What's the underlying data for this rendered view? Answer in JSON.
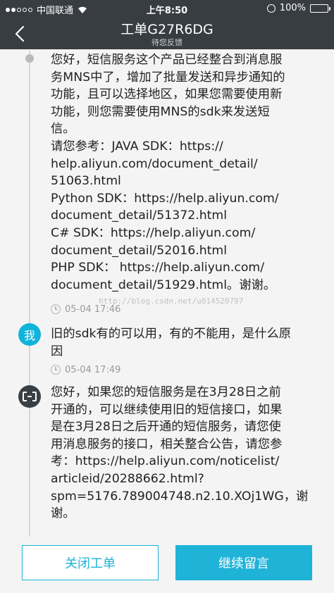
{
  "status_bar": {
    "carrier": "中国联通",
    "time": "上午8:50",
    "battery": "100%"
  },
  "header": {
    "title": "工单G27R6DG",
    "subtitle": "待您反馈"
  },
  "messages": [
    {
      "sender": "service",
      "lines": [
        "您好，短信服务这个产品已经整合到消息服",
        "务MNS中了，增加了批量发送和异步通知的",
        "功能，且可以选择地区，如果您需要使用新",
        "功能，则您需要使用MNS的sdk来发送短",
        "信。",
        "请您参考：JAVA SDK：https://",
        "help.aliyun.com/document_detail/",
        "51063.html",
        "Python SDK：https://help.aliyun.com/",
        "document_detail/51372.html",
        "C# SDK：https://help.aliyun.com/",
        "document_detail/52016.html",
        "PHP SDK： https://help.aliyun.com/",
        "document_detail/51929.html。谢谢。"
      ],
      "timestamp": "05-04 17:46"
    },
    {
      "sender": "me",
      "avatar_label": "我",
      "lines": [
        "旧的sdk有的可以用，有的不能用，是什么原",
        "因"
      ],
      "timestamp": "05-04 17:49"
    },
    {
      "sender": "aliyun",
      "lines": [
        "您好，如果您的短信服务是在3月28日之前",
        "开通的，可以继续使用旧的短信接口，如果",
        "是在3月28日之后开通的短信服务，请您使",
        "用消息服务的接口，相关整合公告，请您参",
        "考：https://help.aliyun.com/noticelist/",
        "articleid/20288662.html?",
        "spm=5176.789004748.n2.10.XOj1WG，谢",
        "谢。"
      ]
    }
  ],
  "watermark": "http://blog.csdn.net/u014520797",
  "actions": {
    "close_label": "关闭工单",
    "continue_label": "继续留言"
  },
  "colors": {
    "header_bg": "#383d42",
    "accent": "#1fb3d8"
  }
}
